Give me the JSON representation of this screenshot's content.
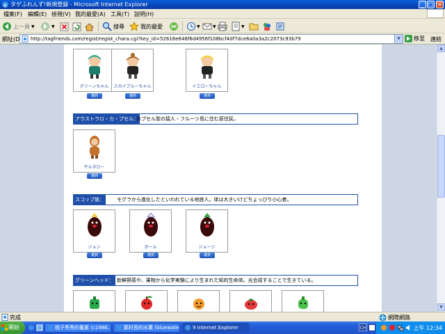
{
  "window": {
    "title": "タゲふれんず!新規登録 - Microsoft Internet Explorer"
  },
  "menu": [
    "檔案(F)",
    "編輯(E)",
    "檢視(V)",
    "我的最愛(A)",
    "工具(T)",
    "說明(H)"
  ],
  "toolbar": {
    "back": "上一頁",
    "search": "搜尋",
    "favorites": "我的最愛"
  },
  "address": {
    "label": "網址(D)",
    "url": "http://tagfriends.com/regist/regist_chara.cgi?key_id=52616e646f6d4956f108bcf40f7dce6a0a3a2c2073c93b79",
    "go": "移至",
    "links": "連結"
  },
  "page": {
    "select_label": "選択",
    "top_row": [
      "グリーンちゃん",
      "スカイブルーちゃん",
      "イエローちゃん"
    ],
    "tribes": [
      {
        "name": "アウストラロ・カ・プセル：",
        "desc": "カプセル型の猿人・フルーツ島に住む原住民。",
        "chars": [
          "サルタロー"
        ]
      },
      {
        "name": "スコップ族：",
        "desc": "モグラから進化したといわれている地底人。体は大きいけどちょっぴり小心者。",
        "chars": [
          "ジョン",
          "ボール",
          "ジョージ"
        ]
      },
      {
        "name": "グリーンヘッド：",
        "desc": "新鮮野菜や、果物から化学実験により生まれた知的生命体。光合成することで生きている。",
        "chars": []
      }
    ]
  },
  "status": {
    "text": "完成",
    "zone": "網際網路"
  },
  "taskbar": {
    "start": "開始",
    "tasks": [
      "桃子秀秀的養素 (c1986...",
      "鄭村長的水菓 (bluewate...",
      "9 Internet Explorer"
    ],
    "lang": "CH",
    "clock": "上午 12:34"
  },
  "colors": {
    "tribe_header": "#1f4fa8",
    "select_button": "#2a64c8",
    "page_margin": "#cdd6e5"
  }
}
